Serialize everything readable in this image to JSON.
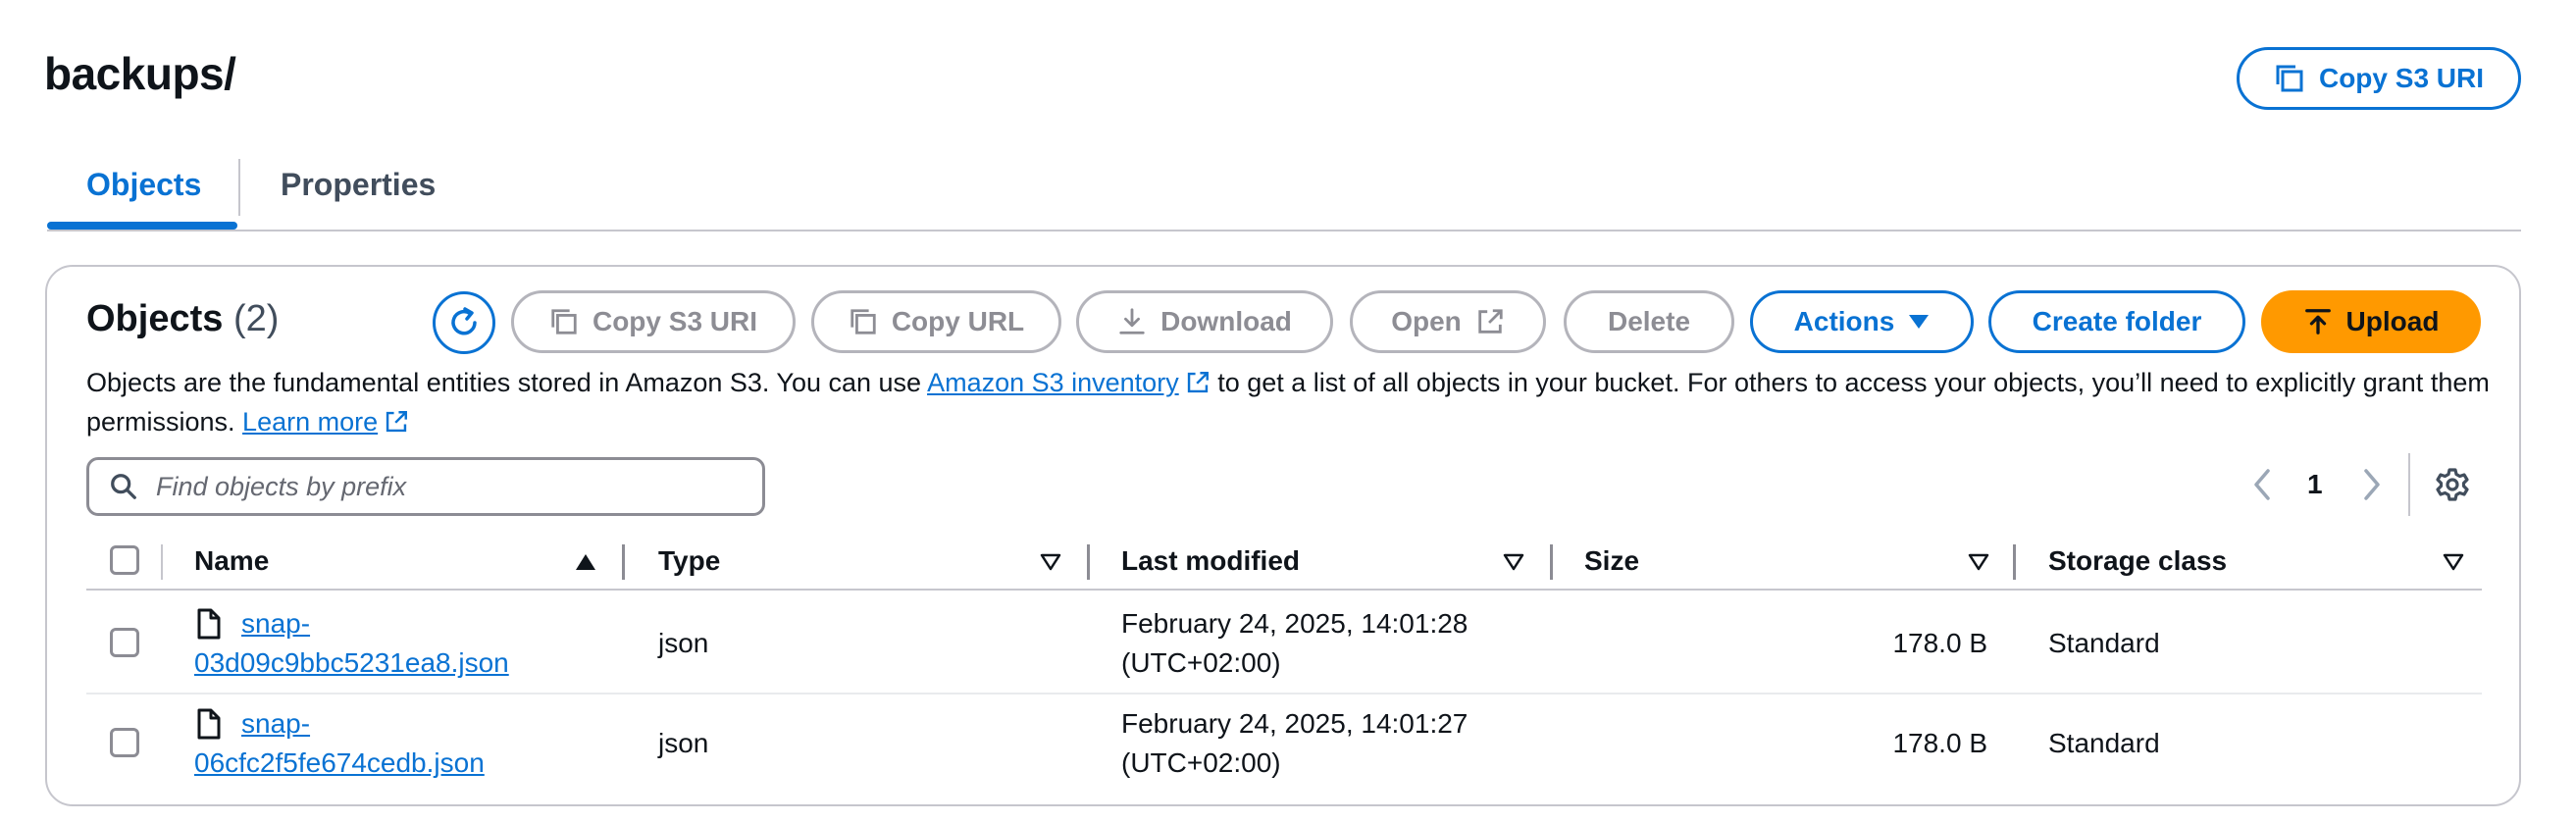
{
  "header": {
    "title": "backups/",
    "copy_s3_uri": "Copy S3 URI"
  },
  "tabs": [
    {
      "label": "Objects",
      "active": true
    },
    {
      "label": "Properties",
      "active": false
    }
  ],
  "objects_panel": {
    "title": "Objects",
    "count": "(2)",
    "toolbar": {
      "copy_s3_uri": "Copy S3 URI",
      "copy_url": "Copy URL",
      "download": "Download",
      "open": "Open",
      "delete": "Delete",
      "actions": "Actions",
      "create_folder": "Create folder",
      "upload": "Upload"
    },
    "description": {
      "part1": "Objects are the fundamental entities stored in Amazon S3. You can use ",
      "link1": "Amazon S3 inventory",
      "part2": " to get a list of all objects in your bucket. For others to access your objects, you’ll need to explicitly grant them permissions. ",
      "link2": "Learn more"
    },
    "search": {
      "placeholder": "Find objects by prefix"
    },
    "pagination": {
      "current_page": "1"
    },
    "table": {
      "columns": [
        "Name",
        "Type",
        "Last modified",
        "Size",
        "Storage class"
      ],
      "rows": [
        {
          "name_line1": "snap-",
          "name_line2": "03d09c9bbc5231ea8.json",
          "type": "json",
          "modified_line1": "February 24, 2025, 14:01:28",
          "modified_line2": "(UTC+02:00)",
          "size": "178.0 B",
          "storage_class": "Standard"
        },
        {
          "name_line1": "snap-",
          "name_line2": "06cfc2f5fe674cedb.json",
          "type": "json",
          "modified_line1": "February 24, 2025, 14:01:27",
          "modified_line2": "(UTC+02:00)",
          "size": "178.0 B",
          "storage_class": "Standard"
        }
      ]
    }
  },
  "colors": {
    "accent": "#0972d3",
    "upload": "#ff9900",
    "disabled": "#8d8d94"
  }
}
